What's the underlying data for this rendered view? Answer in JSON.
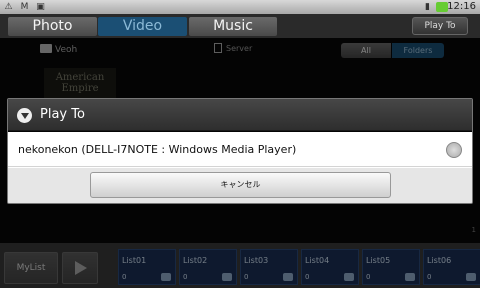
{
  "status_bar": {
    "left_icons": [
      "usb-icon",
      "gmail-icon",
      "android-icon"
    ],
    "right_icons": [
      "signal-icon",
      "battery-icon"
    ],
    "time": "12:16"
  },
  "tabs": [
    {
      "label": "Photo",
      "active": false
    },
    {
      "label": "Video",
      "active": true
    },
    {
      "label": "Music",
      "active": false
    }
  ],
  "play_to_button": "Play To",
  "background": {
    "folder_label": "Veoh",
    "server_label": "Server",
    "segment": {
      "all": "All",
      "folders": "Folders",
      "selected": "Folders"
    },
    "thumbnail_text": "American Empire",
    "page_number": "1"
  },
  "dialog": {
    "title": "Play To",
    "option": "nekonekon (DELL-I7NOTE : Windows Media Player)",
    "cancel": "キャンセル"
  },
  "bottom_bar": {
    "mylist": "MyList",
    "lists": [
      {
        "name": "List01",
        "count": "0"
      },
      {
        "name": "List02",
        "count": "0"
      },
      {
        "name": "List03",
        "count": "0"
      },
      {
        "name": "List04",
        "count": "0"
      },
      {
        "name": "List05",
        "count": "0"
      },
      {
        "name": "List06",
        "count": "0"
      }
    ]
  },
  "colors": {
    "accent": "#1b4f74",
    "list_bg": "#1a2f55"
  }
}
